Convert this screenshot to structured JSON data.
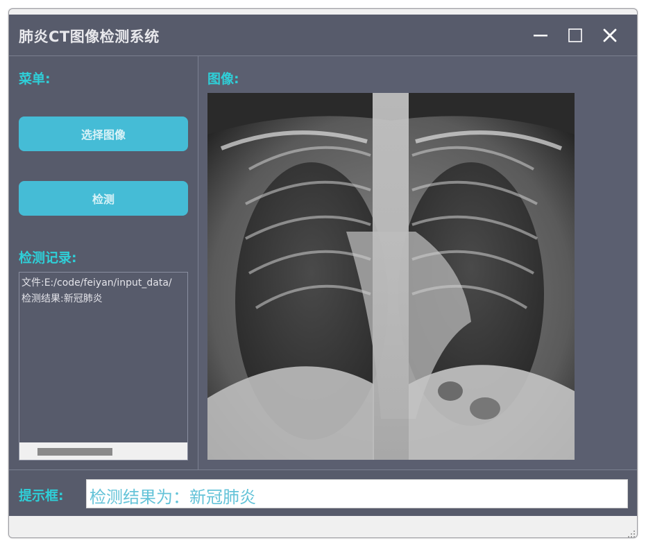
{
  "window": {
    "title": "肺炎CT图像检测系统",
    "minimize_icon": "minimize-icon",
    "maximize_icon": "maximize-icon",
    "close_icon": "close-icon"
  },
  "menu": {
    "label": "菜单:",
    "select_image_button": "选择图像",
    "detect_button": "检测"
  },
  "records": {
    "label": "检测记录:",
    "lines": [
      "文件:E:/code/feiyan/input_data/",
      "检测结果:新冠肺炎"
    ]
  },
  "image_panel": {
    "label": "图像:"
  },
  "prompt": {
    "label": "提示框:",
    "value": "检测结果为：新冠肺炎"
  },
  "colors": {
    "panel_bg": "#575b6b",
    "accent_label": "#2fcfd8",
    "button_bg": "#45bcd6",
    "prompt_text": "#64c3d8"
  }
}
